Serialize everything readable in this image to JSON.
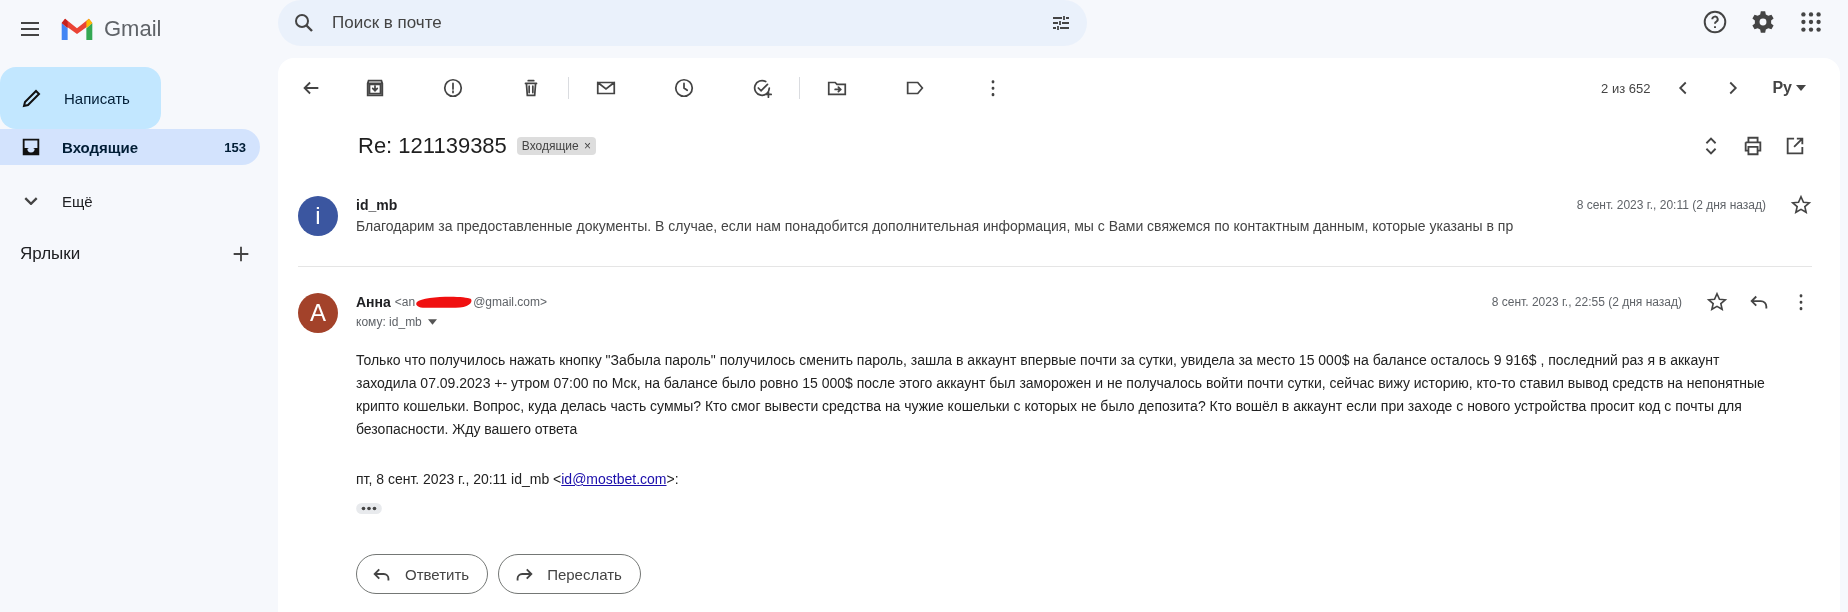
{
  "brand": {
    "name": "Gmail"
  },
  "search": {
    "placeholder": "Поиск в почте"
  },
  "compose": {
    "label": "Написать"
  },
  "sidebar": {
    "items": [
      {
        "kind": "inbox",
        "label": "Входящие",
        "count": "153",
        "selected": true
      },
      {
        "kind": "more",
        "label": "Ещё",
        "selected": false
      }
    ],
    "labels_heading": "Ярлыки"
  },
  "toolbar": {
    "pager": "2 из 652",
    "input_tool": "Ру"
  },
  "thread": {
    "subject": "Re: 121139385",
    "tag": "Входящие",
    "tag_close": "×"
  },
  "messages": [
    {
      "kind": "collapsed",
      "avatar_letter": "i",
      "color": "#3b56a0",
      "sender": "id_mb",
      "snippet": "Благодарим за предоставленные документы. В случае, если нам понадобится дополнительная информация, мы с Вами свяжемся по контактным данным, которые указаны в пр",
      "date": "8 сент. 2023 г., 20:11 (2 дня назад)",
      "starred": false
    },
    {
      "kind": "expanded",
      "avatar_letter": "А",
      "color": "#a3422a",
      "sender": "Анна",
      "email_start": "<an",
      "email_end": "@gmail.com>",
      "redacted": true,
      "recipient": "кому: id_mb",
      "date": "8 сент. 2023 г., 22:55 (2 дня назад)",
      "starred": false,
      "body": "Только что получилось нажать кнопку \"Забыла пароль\" получилось сменить пароль, зашла в аккаунт впервые почти за сутки, увидела за место 15 000$ на балансе осталось 9 916$ , последний раз я в аккаунт заходила 07.09.2023 +-  утром 07:00 по Мск, на балансе было ровно 15 000$ после этого аккаунт был заморожен и не получалось войти почти сутки, сейчас вижу историю, кто-то ставил вывод средств на непонятные крипто кошельки. Вопрос, куда делась часть суммы? Кто смог вывести средства на чужие кошельки с которых не было депозита? Кто вошёл в аккаунт если при заходе с нового устройства просит код с почты для безопасности. Жду вашего ответа",
      "quote_intro": "пт, 8 сент. 2023 г., 20:11 id_mb <",
      "quote_link": "id@mostbet.com",
      "quote_end": ">:"
    }
  ],
  "actions": [
    {
      "kind": "reply",
      "label": "Ответить"
    },
    {
      "kind": "forward",
      "label": "Переслать"
    }
  ]
}
